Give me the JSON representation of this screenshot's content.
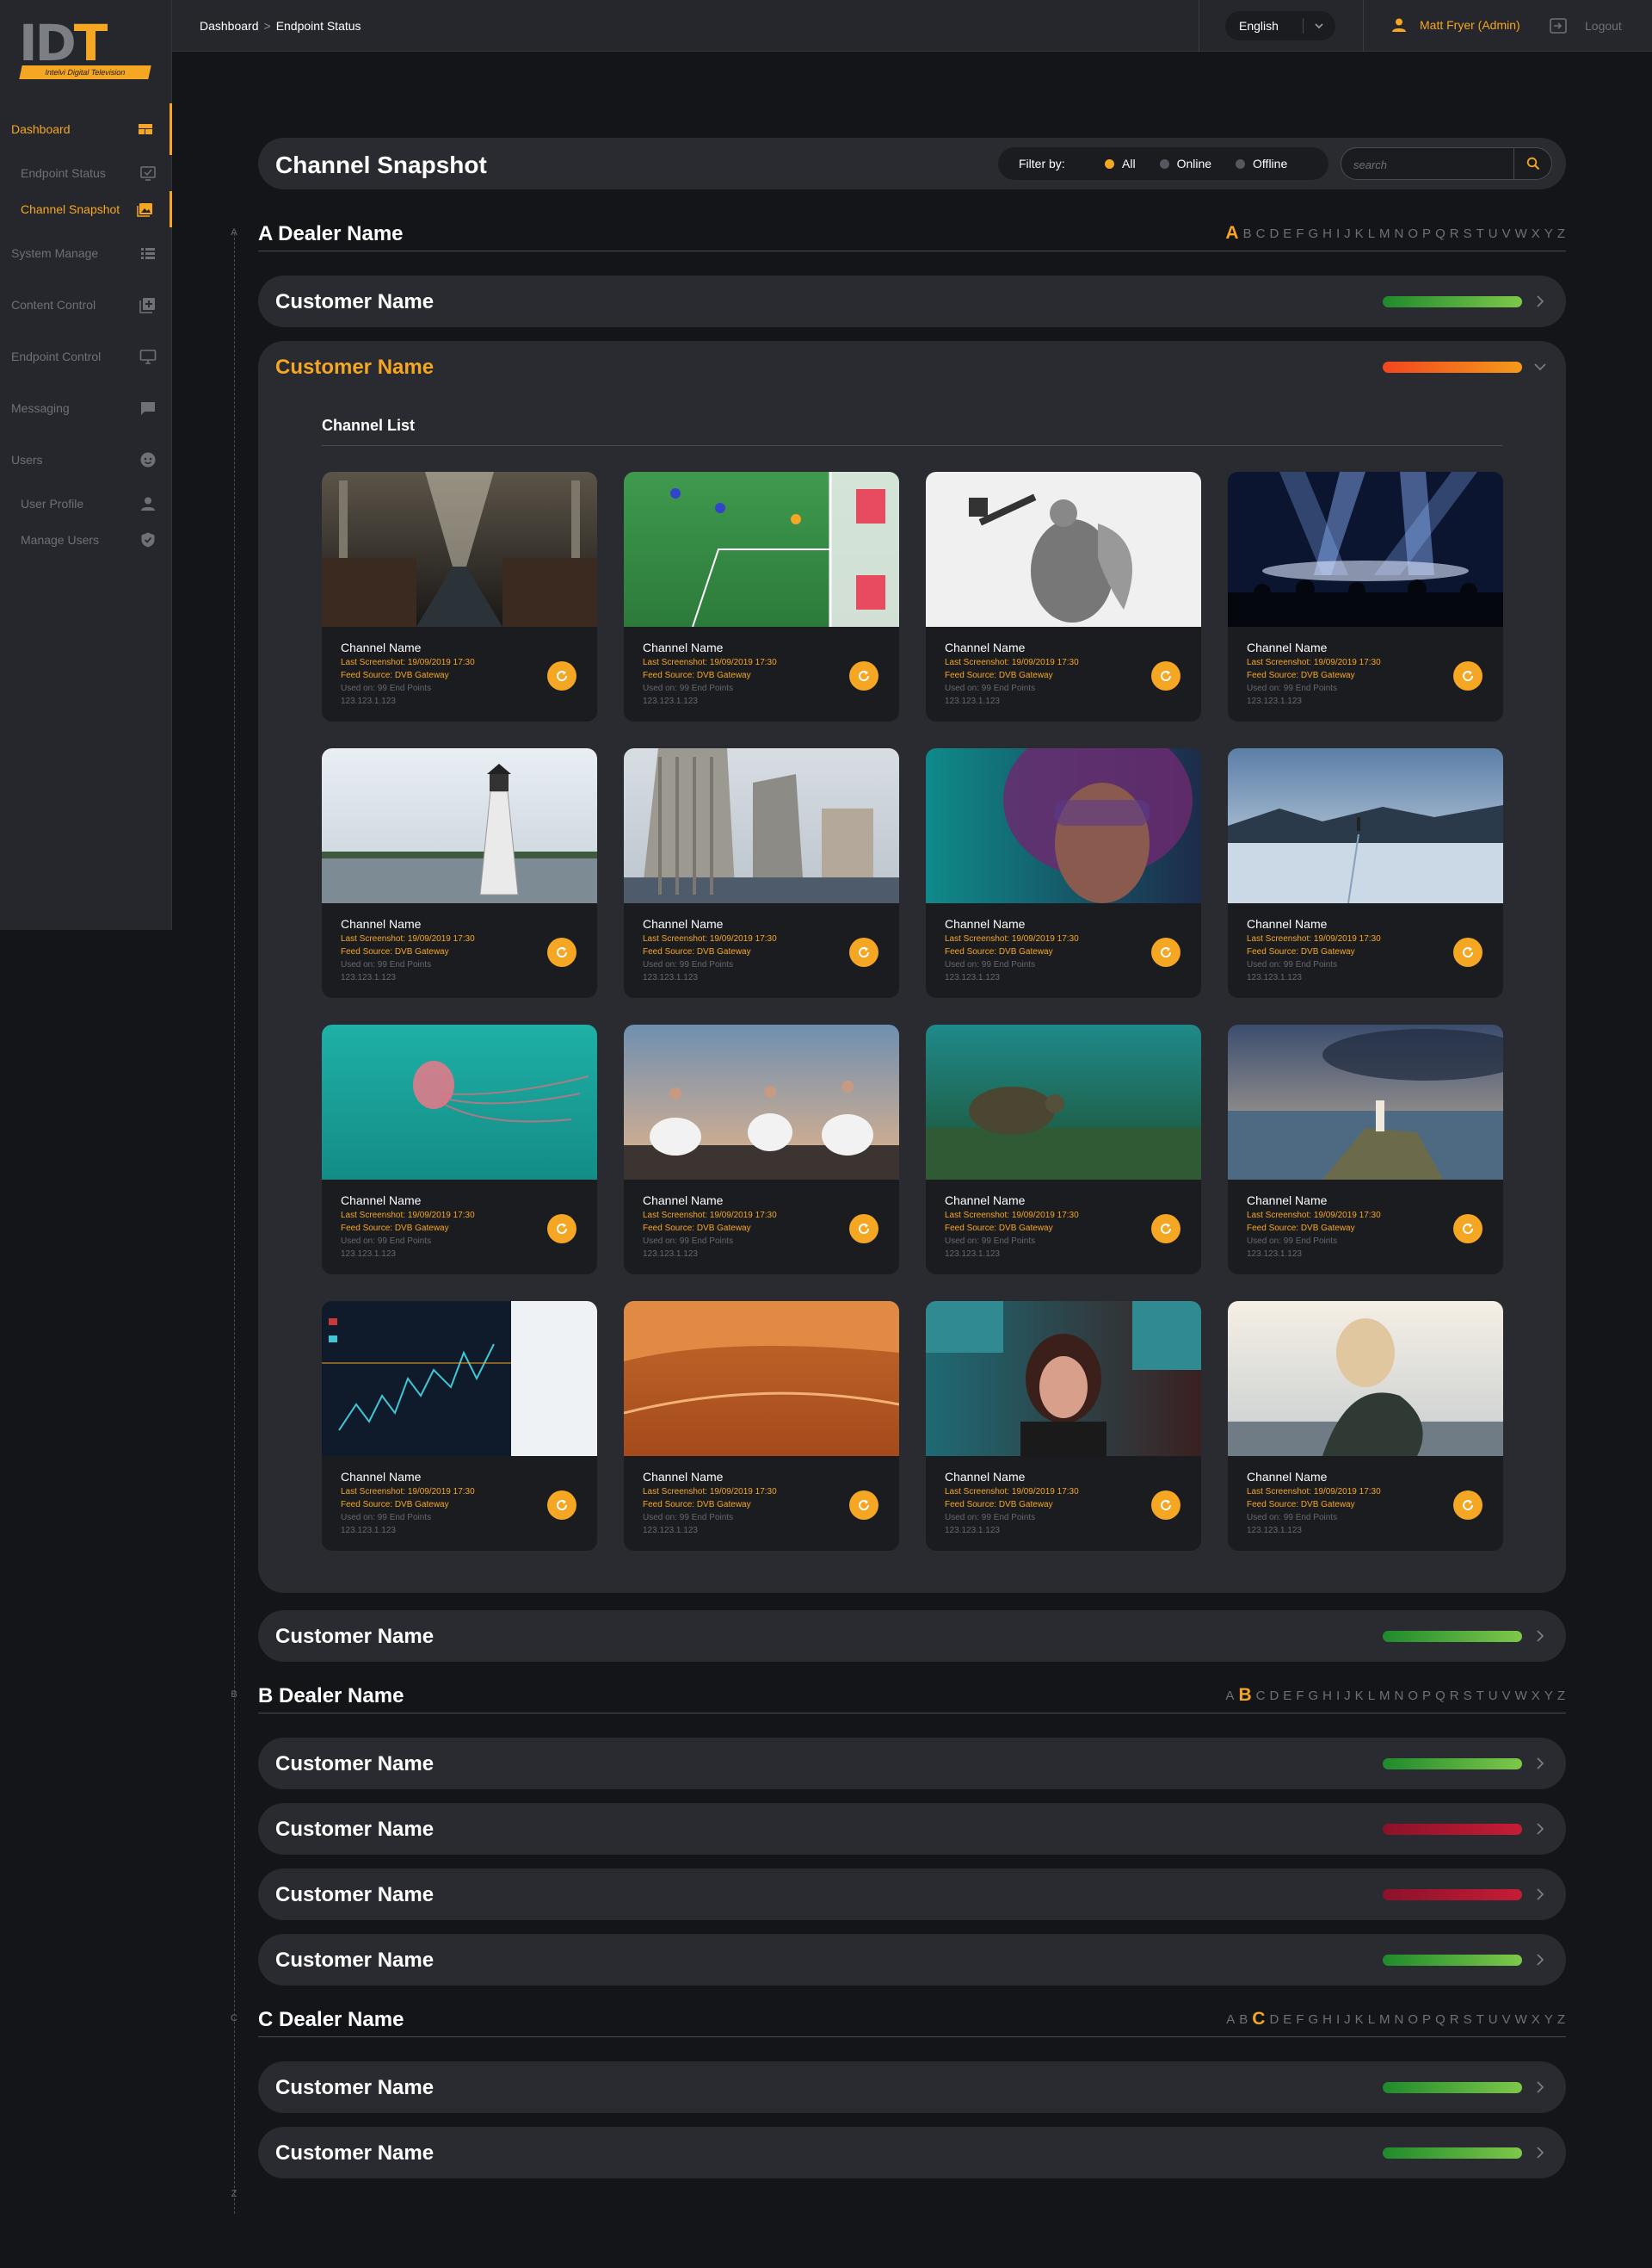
{
  "app": {
    "logo_text": "IDT",
    "logo_tagline": "Intelvi Digital Television"
  },
  "topbar": {
    "breadcrumb": [
      "Dashboard",
      "Endpoint Status"
    ],
    "breadcrumb_sep": ">",
    "language": "English",
    "user": "Matt Fryer (Admin)",
    "logout": "Logout"
  },
  "sidebar": {
    "items": [
      {
        "label": "Dashboard",
        "icon": "dashboard-icon",
        "active": true
      },
      {
        "label": "Endpoint Status",
        "icon": "monitor-check-icon",
        "sub": true
      },
      {
        "label": "Channel Snapshot",
        "icon": "image-icon",
        "sub": true,
        "active": true
      },
      {
        "label": "System Manage",
        "icon": "list-icon"
      },
      {
        "label": "Content Control",
        "icon": "add-box-icon"
      },
      {
        "label": "Endpoint Control",
        "icon": "desktop-icon"
      },
      {
        "label": "Messaging",
        "icon": "chat-icon"
      },
      {
        "label": "Users",
        "icon": "face-icon"
      },
      {
        "label": "User Profile",
        "icon": "person-icon",
        "sub": true
      },
      {
        "label": "Manage Users",
        "icon": "shield-icon",
        "sub": true
      }
    ]
  },
  "page": {
    "title": "Channel Snapshot",
    "filter_label": "Filter by:",
    "filters": [
      {
        "label": "All",
        "active": true
      },
      {
        "label": "Online",
        "active": false
      },
      {
        "label": "Offline",
        "active": false
      }
    ],
    "search_placeholder": "search"
  },
  "alphabet": [
    "A",
    "B",
    "C",
    "D",
    "E",
    "F",
    "G",
    "H",
    "I",
    "J",
    "K",
    "L",
    "M",
    "N",
    "O",
    "P",
    "Q",
    "R",
    "S",
    "T",
    "U",
    "V",
    "W",
    "X",
    "Y",
    "Z"
  ],
  "timeline_letters": [
    "A",
    "B",
    "C",
    "Z"
  ],
  "colors": {
    "accent": "#f5a623",
    "online": "#4caf50",
    "warning": "#f1461e",
    "offline": "#c61c36"
  },
  "channel_list_title": "Channel List",
  "card_template": {
    "title": "Channel Name",
    "last_screenshot": "Last Screenshot: 19/09/2019 17:30",
    "feed_source": "Feed Source: DVB Gateway",
    "used_on": "Used on: 99 End Points",
    "ip": "123.123.1.123"
  },
  "thumbnails": [
    "library-corridor",
    "football-goal",
    "angel-statue",
    "concert-lights",
    "lighthouse-water",
    "city-skyscrapers",
    "helmet-woman",
    "snow-lake",
    "jellyfish",
    "ballet-dancers",
    "sea-turtle",
    "coastal-lighthouse",
    "stock-chart",
    "desert-dunes",
    "woman-portrait",
    "blonde-woman"
  ],
  "dealers": [
    {
      "name": "A Dealer Name",
      "letter": "A",
      "customers": [
        {
          "name": "Customer Name",
          "status": "green",
          "expanded": false
        },
        {
          "name": "Customer Name",
          "status": "orange",
          "expanded": true
        },
        {
          "name": "Customer Name",
          "status": "green",
          "expanded": false
        }
      ]
    },
    {
      "name": "B Dealer Name",
      "letter": "B",
      "customers": [
        {
          "name": "Customer Name",
          "status": "green",
          "expanded": false
        },
        {
          "name": "Customer Name",
          "status": "red",
          "expanded": false
        },
        {
          "name": "Customer Name",
          "status": "red",
          "expanded": false
        },
        {
          "name": "Customer Name",
          "status": "green",
          "expanded": false
        }
      ]
    },
    {
      "name": "C Dealer Name",
      "letter": "C",
      "customers": [
        {
          "name": "Customer Name",
          "status": "green",
          "expanded": false
        },
        {
          "name": "Customer Name",
          "status": "green",
          "expanded": false
        }
      ]
    }
  ]
}
